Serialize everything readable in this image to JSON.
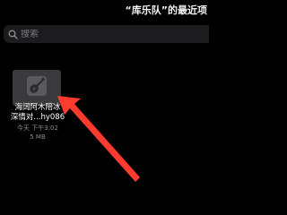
{
  "window": {
    "title": "“库乐队”的最近项"
  },
  "search": {
    "placeholder": "搜索",
    "icon": "search-icon"
  },
  "files": [
    {
      "name_line1": "海阔阿木陪冰",
      "name_line2": "深情对...hy086",
      "date": "今天 下午3:02",
      "size": "5 MB",
      "icon": "guitar-icon"
    }
  ],
  "annotation": {
    "color": "#ff3b30"
  }
}
